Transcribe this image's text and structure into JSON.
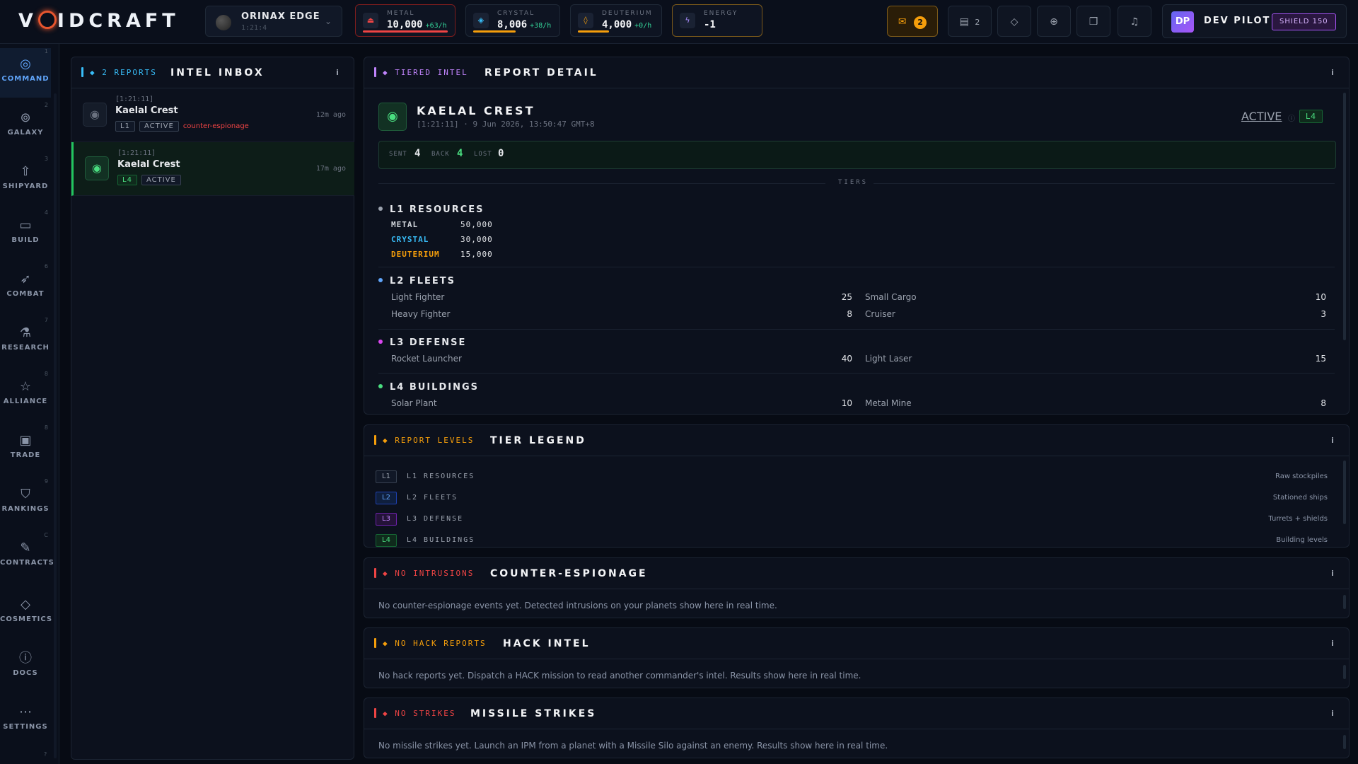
{
  "brand": {
    "pre": "V",
    "post": "IDCRAFT"
  },
  "planet": {
    "name": "ORINAX EDGE",
    "coords": "1:21:4"
  },
  "resources": [
    {
      "label": "METAL",
      "value": "10,000",
      "rate": "+63/h",
      "color": "#ef4444",
      "fill": 1.0,
      "icon": "drill-icon"
    },
    {
      "label": "CRYSTAL",
      "value": "8,006",
      "rate": "+38/h",
      "color": "#f59e0b",
      "fill": 0.55,
      "icon": "crystal-icon"
    },
    {
      "label": "DEUTERIUM",
      "value": "4,000",
      "rate": "+0/h",
      "color": "#f59e0b",
      "fill": 0.4,
      "icon": "drop-icon"
    },
    {
      "label": "ENERGY",
      "value": "-1",
      "rate": "",
      "color": "#a78bfa",
      "fill": 0,
      "icon": "bolt-icon"
    }
  ],
  "toolbar": {
    "mail_count": "2",
    "tasks_count": "2"
  },
  "user": {
    "initials": "DP",
    "name": "DEV PILOT",
    "shield": "SHIELD 150"
  },
  "sidebar": [
    {
      "key": "1",
      "label": "COMMAND",
      "icon": "◎"
    },
    {
      "key": "2",
      "label": "GALAXY",
      "icon": "⊚"
    },
    {
      "key": "3",
      "label": "SHIPYARD",
      "icon": "⇧"
    },
    {
      "key": "4",
      "label": "BUILD",
      "icon": "▭"
    },
    {
      "key": "6",
      "label": "COMBAT",
      "icon": "➶"
    },
    {
      "key": "7",
      "label": "RESEARCH",
      "icon": "⚗"
    },
    {
      "key": "8",
      "label": "ALLIANCE",
      "icon": "☆"
    },
    {
      "key": "8",
      "label": "TRADE",
      "icon": "▣"
    },
    {
      "key": "9",
      "label": "RANKINGS",
      "icon": "⛉"
    },
    {
      "key": "C",
      "label": "CONTRACTS",
      "icon": "✎"
    },
    {
      "key": "",
      "label": "COSMETICS",
      "icon": "◇"
    },
    {
      "key": "",
      "label": "DOCS",
      "icon": "ⓘ"
    },
    {
      "key": "",
      "label": "SETTINGS",
      "icon": "⋯"
    }
  ],
  "sidebar_footer_key": "?",
  "inbox": {
    "tag": "◆ 2 REPORTS",
    "title": "INTEL INBOX",
    "info": "i",
    "messages": [
      {
        "coords": "[1:21:11]",
        "name": "Kaelal Crest",
        "level": "L1",
        "status": "ACTIVE",
        "extra": "counter-espionage",
        "ago": "12m ago"
      },
      {
        "coords": "[1:21:11]",
        "name": "Kaelal Crest",
        "level": "L4",
        "status": "ACTIVE",
        "extra": "",
        "ago": "17m ago"
      }
    ]
  },
  "detail": {
    "tag": "◆ TIERED INTEL",
    "title": "REPORT DETAIL",
    "info": "i",
    "target": "KAELAL CREST",
    "meta": "[1:21:11] · 9 Jun 2026, 13:50:47 GMT+8",
    "status": "ACTIVE",
    "level": "L4",
    "probes": {
      "sent_label": "SENT",
      "sent": "4",
      "back_label": "BACK",
      "back": "4",
      "lost_label": "LOST",
      "lost": "0"
    },
    "tiers_label": "TIERS",
    "l1": {
      "title": "L1 RESOURCES",
      "rows": [
        {
          "name": "METAL",
          "value": "50,000",
          "color": "#d1d5db"
        },
        {
          "name": "CRYSTAL",
          "value": "30,000",
          "color": "#38bdf8"
        },
        {
          "name": "DEUTERIUM",
          "value": "15,000",
          "color": "#f59e0b"
        }
      ]
    },
    "l2": {
      "title": "L2 FLEETS",
      "rows": [
        {
          "a": "Light Fighter",
          "av": "25",
          "b": "Small Cargo",
          "bv": "10"
        },
        {
          "a": "Heavy Fighter",
          "av": "8",
          "b": "Cruiser",
          "bv": "3"
        }
      ]
    },
    "l3": {
      "title": "L3 DEFENSE",
      "rows": [
        {
          "a": "Rocket Launcher",
          "av": "40",
          "b": "Light Laser",
          "bv": "15"
        }
      ]
    },
    "l4": {
      "title": "L4 BUILDINGS",
      "rows": [
        {
          "a": "Solar Plant",
          "av": "10",
          "b": "Metal Mine",
          "bv": "8"
        }
      ]
    }
  },
  "legend": {
    "tag": "◆ REPORT LEVELS",
    "title": "TIER LEGEND",
    "info": "i",
    "rows": [
      {
        "badge": "L1",
        "name": "L1 RESOURCES",
        "desc": "Raw stockpiles",
        "color": "#9ca3af"
      },
      {
        "badge": "L2",
        "name": "L2 FLEETS",
        "desc": "Stationed ships",
        "color": "#60a5fa"
      },
      {
        "badge": "L3",
        "name": "L3 DEFENSE",
        "desc": "Turrets + shields",
        "color": "#c084fc"
      },
      {
        "badge": "L4",
        "name": "L4 BUILDINGS",
        "desc": "Building levels",
        "color": "#4ade80"
      }
    ]
  },
  "counter": {
    "tag": "◆ NO INTRUSIONS",
    "title": "COUNTER-ESPIONAGE",
    "info": "i",
    "text": "No counter-espionage events yet. Detected intrusions on your planets show here in real time."
  },
  "hack": {
    "tag": "◆ NO HACK REPORTS",
    "title": "HACK INTEL",
    "info": "i",
    "text": "No hack reports yet. Dispatch a HACK mission to read another commander's intel. Results show here in real time."
  },
  "missile": {
    "tag": "◆ NO STRIKES",
    "title": "MISSILE STRIKES",
    "info": "i",
    "text": "No missile strikes yet. Launch an IPM from a planet with a Missile Silo against an enemy. Results show here in real time."
  }
}
